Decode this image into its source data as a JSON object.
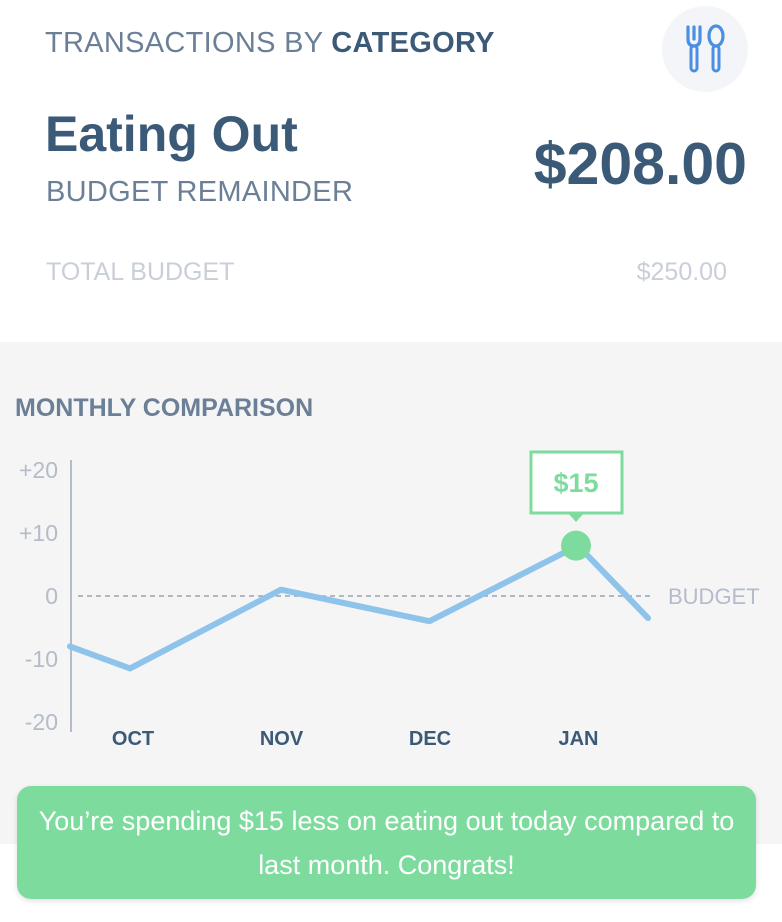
{
  "header": {
    "title_prefix": "TRANSACTIONS BY ",
    "title_emphasis": "CATEGORY",
    "icon": "utensils-icon"
  },
  "category": {
    "name": "Eating Out",
    "subtitle": "BUDGET REMAINDER",
    "amount": "$208.00"
  },
  "total_budget": {
    "label": "TOTAL BUDGET",
    "value": "$250.00"
  },
  "comparison": {
    "title": "MONTHLY COMPARISON"
  },
  "chart_data": {
    "type": "line",
    "title": "MONTHLY COMPARISON",
    "y_ticks": [
      "+20",
      "+10",
      "0",
      "-10",
      "-20"
    ],
    "ylim": [
      -20,
      20
    ],
    "categories": [
      "OCT",
      "NOV",
      "DEC",
      "JAN"
    ],
    "series": [
      {
        "x": [
          -1.4,
          -1,
          0,
          1,
          2,
          2.5
        ],
        "values": [
          -8,
          -11.5,
          1,
          -4,
          8,
          -3.5
        ]
      }
    ],
    "reference_line": {
      "value": 0,
      "label": "BUDGET"
    },
    "highlight": {
      "x": 2,
      "value": 8,
      "label": "$15"
    },
    "colors": {
      "line": "#8ec3ea",
      "highlight": "#7ddc9d",
      "axis": "#b3bcc8",
      "tick_label": "#b3bcc8",
      "category_label": "#3b5a78"
    }
  },
  "message": {
    "text": "You’re spending $15 less on eating out today compared to last month. Congrats!"
  },
  "colors": {
    "primary_text": "#3b5a78",
    "secondary_text": "#6b7f96",
    "muted_text": "#c9ced8",
    "success": "#7ddc9d",
    "icon_blue": "#4a90e2"
  }
}
